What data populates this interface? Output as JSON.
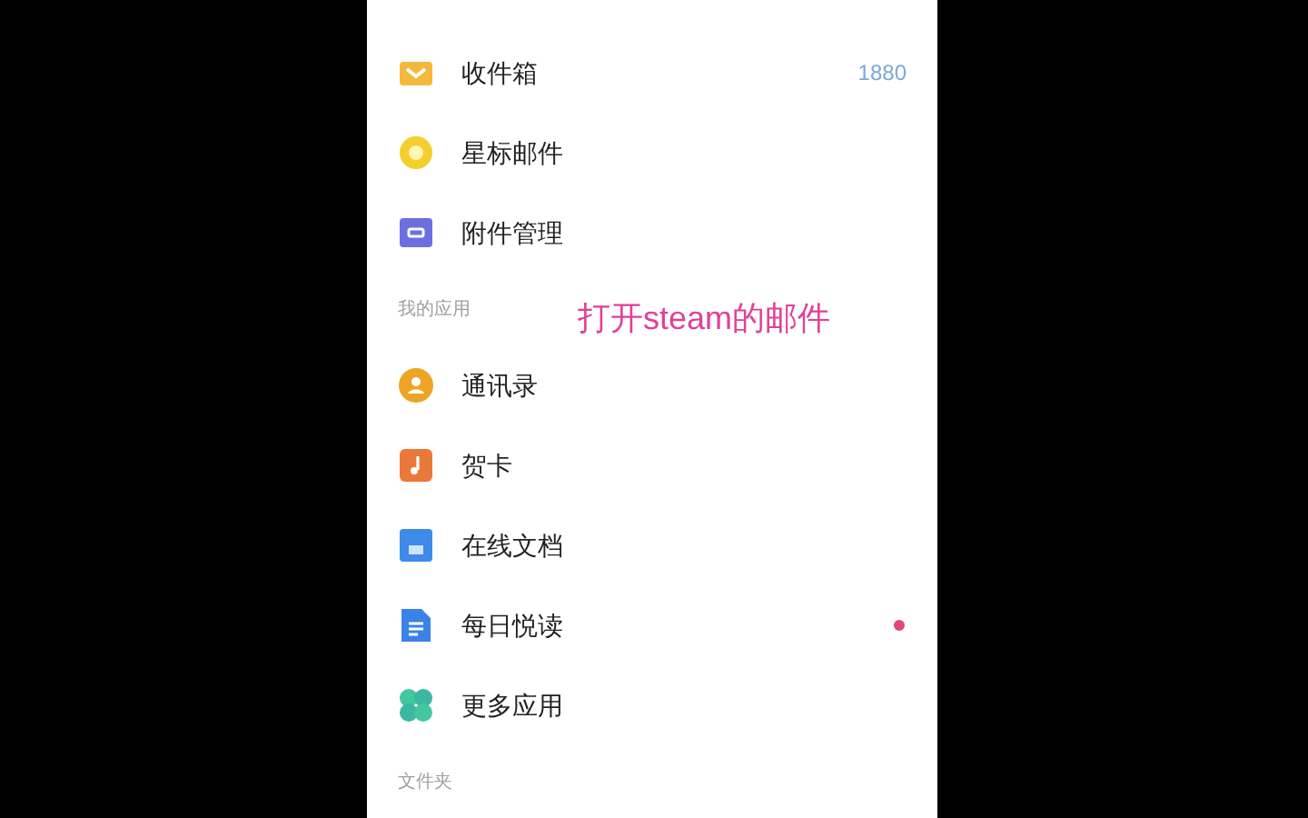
{
  "sections": [
    {
      "items": [
        {
          "kind": "inbox",
          "label": "收件箱",
          "badge": "1880",
          "unread": false
        },
        {
          "kind": "star",
          "label": "星标邮件",
          "unread": false
        },
        {
          "kind": "attachment",
          "label": "附件管理",
          "unread": false
        }
      ]
    },
    {
      "title": "我的应用",
      "items": [
        {
          "kind": "contacts",
          "label": "通讯录",
          "unread": false
        },
        {
          "kind": "card",
          "label": "贺卡",
          "unread": false
        },
        {
          "kind": "doc",
          "label": "在线文档",
          "unread": false
        },
        {
          "kind": "reading",
          "label": "每日悦读",
          "unread": true
        },
        {
          "kind": "apps",
          "label": "更多应用",
          "unread": false
        }
      ]
    },
    {
      "title": "文件夹"
    }
  ],
  "caption": "打开steam的邮件"
}
